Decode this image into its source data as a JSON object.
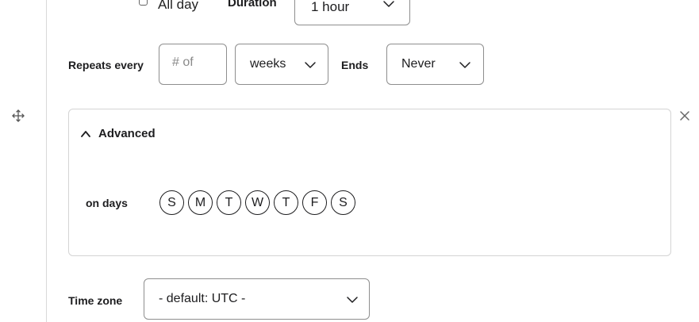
{
  "top_row": {
    "all_day_label": "All day",
    "duration_label": "Duration",
    "duration_value": "1 hour"
  },
  "repeats": {
    "label": "Repeats every",
    "count_placeholder": "# of",
    "unit_value": "weeks",
    "ends_label": "Ends",
    "ends_value": "Never"
  },
  "advanced": {
    "toggle_label": "Advanced",
    "on_days_label": "on days",
    "days": [
      "S",
      "M",
      "T",
      "W",
      "T",
      "F",
      "S"
    ]
  },
  "timezone": {
    "label": "Time zone",
    "value": "- default: UTC -"
  },
  "icons": {
    "move": "move-arrows-icon",
    "close": "close-icon",
    "chevron_down": "chevron-down-icon",
    "chevron_up": "chevron-up-icon"
  }
}
